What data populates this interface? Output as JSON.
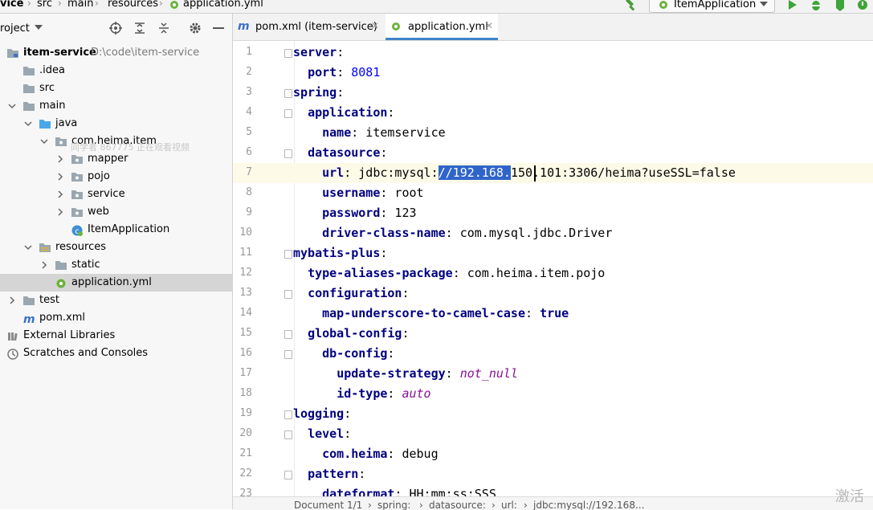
{
  "breadcrumb": {
    "items": [
      "vice",
      "src",
      "main",
      "resources",
      "application.yml"
    ]
  },
  "toolbar": {
    "run_config_label": "ItemApplication"
  },
  "project_panel": {
    "title": "roject",
    "tree": [
      {
        "label": "item-service",
        "hint": "D:\\code\\item-service",
        "bold": true,
        "icon": "module-folder-icon"
      },
      {
        "label": ".idea",
        "icon": "folder-icon"
      },
      {
        "label": "src",
        "icon": "folder-icon"
      },
      {
        "label": "main",
        "icon": "folder-icon"
      },
      {
        "label": "java",
        "icon": "source-folder-icon"
      },
      {
        "label": "com.heima.item",
        "icon": "package-icon"
      },
      {
        "label": "mapper",
        "icon": "package-icon"
      },
      {
        "label": "pojo",
        "icon": "package-icon"
      },
      {
        "label": "service",
        "icon": "package-icon"
      },
      {
        "label": "web",
        "icon": "package-icon"
      },
      {
        "label": "ItemApplication",
        "icon": "spring-class-icon"
      },
      {
        "label": "resources",
        "icon": "resources-folder-icon"
      },
      {
        "label": "static",
        "icon": "folder-icon"
      },
      {
        "label": "application.yml",
        "icon": "yaml-file-icon"
      },
      {
        "label": "test",
        "icon": "folder-icon"
      },
      {
        "label": "pom.xml",
        "icon": "maven-file-icon"
      },
      {
        "label": "External Libraries",
        "icon": "library-icon"
      },
      {
        "label": "Scratches and Consoles",
        "icon": "scratch-icon"
      }
    ],
    "overlay_text": "同学者 867775 正在观看视频"
  },
  "tabs": [
    {
      "label": "pom.xml (item-service)",
      "icon": "maven-file-icon",
      "active": false
    },
    {
      "label": "application.yml",
      "icon": "yaml-file-icon",
      "active": true
    }
  ],
  "editor": {
    "current_line": 7,
    "lines": [
      {
        "n": "1",
        "segments": [
          {
            "t": "server",
            "c": "key"
          },
          {
            "t": ":"
          }
        ]
      },
      {
        "n": "2",
        "segments": [
          {
            "t": "  "
          },
          {
            "t": "port",
            "c": "key"
          },
          {
            "t": ": "
          },
          {
            "t": "8081",
            "c": "num"
          }
        ]
      },
      {
        "n": "3",
        "segments": [
          {
            "t": "spring",
            "c": "key"
          },
          {
            "t": ":"
          }
        ]
      },
      {
        "n": "4",
        "segments": [
          {
            "t": "  "
          },
          {
            "t": "application",
            "c": "key"
          },
          {
            "t": ":"
          }
        ]
      },
      {
        "n": "5",
        "segments": [
          {
            "t": "    "
          },
          {
            "t": "name",
            "c": "key"
          },
          {
            "t": ": itemservice"
          }
        ]
      },
      {
        "n": "6",
        "segments": [
          {
            "t": "  "
          },
          {
            "t": "datasource",
            "c": "key"
          },
          {
            "t": ":"
          }
        ]
      },
      {
        "n": "7",
        "segments": [
          {
            "t": "    "
          },
          {
            "t": "url",
            "c": "key"
          },
          {
            "t": ": jdbc:mysql:"
          },
          {
            "t": "//192.168.",
            "c": "sel"
          },
          {
            "t": "150.101:3306/heima?useSSL=false"
          }
        ]
      },
      {
        "n": "8",
        "segments": [
          {
            "t": "    "
          },
          {
            "t": "username",
            "c": "key"
          },
          {
            "t": ": root"
          }
        ]
      },
      {
        "n": "9",
        "segments": [
          {
            "t": "    "
          },
          {
            "t": "password",
            "c": "key"
          },
          {
            "t": ": 123"
          }
        ]
      },
      {
        "n": "10",
        "segments": [
          {
            "t": "    "
          },
          {
            "t": "driver-class-name",
            "c": "key"
          },
          {
            "t": ": com.mysql.jdbc.Driver"
          }
        ]
      },
      {
        "n": "11",
        "segments": [
          {
            "t": "mybatis-plus",
            "c": "key"
          },
          {
            "t": ":"
          }
        ]
      },
      {
        "n": "12",
        "segments": [
          {
            "t": "  "
          },
          {
            "t": "type-aliases-package",
            "c": "key"
          },
          {
            "t": ": com.heima.item.pojo"
          }
        ]
      },
      {
        "n": "13",
        "segments": [
          {
            "t": "  "
          },
          {
            "t": "configuration",
            "c": "key"
          },
          {
            "t": ":"
          }
        ]
      },
      {
        "n": "14",
        "segments": [
          {
            "t": "    "
          },
          {
            "t": "map-underscore-to-camel-case",
            "c": "key"
          },
          {
            "t": ": "
          },
          {
            "t": "true",
            "c": "bool"
          }
        ]
      },
      {
        "n": "15",
        "segments": [
          {
            "t": "  "
          },
          {
            "t": "global-config",
            "c": "key"
          },
          {
            "t": ":"
          }
        ]
      },
      {
        "n": "16",
        "segments": [
          {
            "t": "    "
          },
          {
            "t": "db-config",
            "c": "key"
          },
          {
            "t": ":"
          }
        ]
      },
      {
        "n": "17",
        "segments": [
          {
            "t": "      "
          },
          {
            "t": "update-strategy",
            "c": "key"
          },
          {
            "t": ": "
          },
          {
            "t": "not_null",
            "c": "ital"
          }
        ]
      },
      {
        "n": "18",
        "segments": [
          {
            "t": "      "
          },
          {
            "t": "id-type",
            "c": "key"
          },
          {
            "t": ": "
          },
          {
            "t": "auto",
            "c": "ital"
          }
        ]
      },
      {
        "n": "19",
        "segments": [
          {
            "t": "logging",
            "c": "key"
          },
          {
            "t": ":"
          }
        ]
      },
      {
        "n": "20",
        "segments": [
          {
            "t": "  "
          },
          {
            "t": "level",
            "c": "key"
          },
          {
            "t": ":"
          }
        ]
      },
      {
        "n": "21",
        "segments": [
          {
            "t": "    "
          },
          {
            "t": "com.heima",
            "c": "key"
          },
          {
            "t": ": debug"
          }
        ]
      },
      {
        "n": "22",
        "segments": [
          {
            "t": "  "
          },
          {
            "t": "pattern",
            "c": "key"
          },
          {
            "t": ":"
          }
        ]
      },
      {
        "n": "23",
        "segments": [
          {
            "t": "    "
          },
          {
            "t": "dateformat",
            "c": "key"
          },
          {
            "t": ": HH:mm:ss:SSS"
          }
        ]
      }
    ]
  },
  "statusbar": {
    "items": [
      "Document 1/1",
      "spring:",
      "datasource:",
      "url:",
      "jdbc:mysql://192.168..."
    ]
  },
  "overlay": {
    "activate_text": "激活"
  },
  "colors": {
    "accent": "#4083c9",
    "selection": "#2f65ca",
    "yaml_key": "#000080",
    "number": "#0000ff",
    "current_line": "#fdfae8"
  }
}
